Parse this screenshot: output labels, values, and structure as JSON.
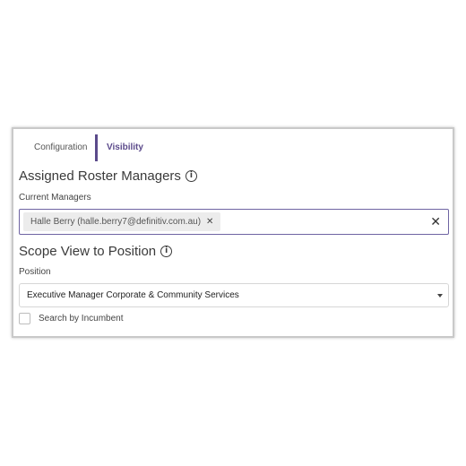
{
  "tabs": [
    {
      "label": "Configuration"
    },
    {
      "label": "Visibility"
    }
  ],
  "assigned": {
    "title": "Assigned Roster Managers",
    "info_icon": "i",
    "current_label": "Current Managers",
    "chip_text": "Halle Berry (halle.berry7@definitiv.com.au)",
    "chip_remove": "✕",
    "clear_all": "✕"
  },
  "scope": {
    "title": "Scope View to Position",
    "info_icon": "i",
    "position_label": "Position",
    "position_value": "Executive Manager Corporate & Community Services",
    "checkbox_label": "Search by Incumbent"
  },
  "colors": {
    "accent": "#5b4a8b"
  }
}
